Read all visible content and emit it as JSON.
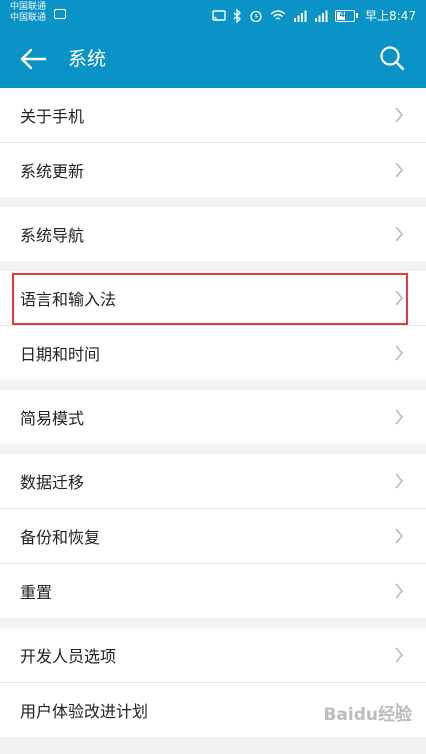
{
  "status_bar": {
    "carrier_1": "中国联通",
    "carrier_2": "中国联通",
    "battery": "46",
    "time": "早上8:47"
  },
  "app_bar": {
    "title": "系统"
  },
  "groups": [
    {
      "items": [
        {
          "label": "关于手机"
        },
        {
          "label": "系统更新"
        }
      ]
    },
    {
      "items": [
        {
          "label": "系统导航"
        }
      ]
    },
    {
      "items": [
        {
          "label": "语言和输入法"
        },
        {
          "label": "日期和时间"
        }
      ]
    },
    {
      "items": [
        {
          "label": "简易模式"
        }
      ]
    },
    {
      "items": [
        {
          "label": "数据迁移"
        },
        {
          "label": "备份和恢复"
        },
        {
          "label": "重置"
        }
      ]
    },
    {
      "items": [
        {
          "label": "开发人员选项"
        },
        {
          "label": "用户体验改进计划"
        }
      ]
    }
  ],
  "watermark": "Baidu经验",
  "colors": {
    "primary": "#0a93c7",
    "highlight": "#e53b3b",
    "background": "#f2f2f2"
  }
}
